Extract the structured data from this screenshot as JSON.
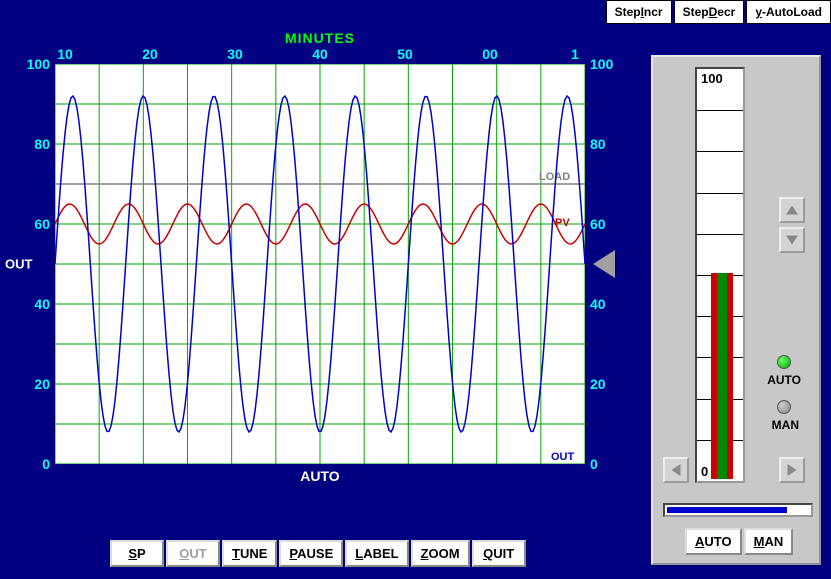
{
  "top_tabs": {
    "step_incr": "StepIncr",
    "step_decr": "StepDecr",
    "autoload": "y-AutoLoad"
  },
  "chart_data": {
    "type": "line",
    "title_top": "MINUTES",
    "x_ticks": [
      "10",
      "20",
      "30",
      "40",
      "50",
      "00",
      "1"
    ],
    "ylim": [
      0,
      100
    ],
    "y_ticks_left": [
      100,
      80,
      60,
      40,
      20,
      0
    ],
    "y_ticks_right": [
      100,
      80,
      60,
      40,
      20,
      0
    ],
    "y_left_label": "OUT",
    "series": [
      {
        "name": "LOAD",
        "color": "#808080",
        "type": "line",
        "level": 70
      },
      {
        "name": "PV",
        "color": "#cc0000",
        "type": "sine",
        "center": 60,
        "amp": 5,
        "cycles": 9
      },
      {
        "name": "OUT",
        "color": "#0000cc",
        "type": "sine",
        "center": 50,
        "amp": 42,
        "cycles": 7.5
      }
    ],
    "marker_y": 50
  },
  "status_text": "AUTO",
  "buttons": {
    "sp": "SP",
    "out": "OUT",
    "tune": "TUNE",
    "pause": "PAUSE",
    "label": "LABEL",
    "zoom": "ZOOM",
    "quit": "QUIT"
  },
  "bar": {
    "top_value": "100",
    "bottom_value": "0",
    "red_pct": 50,
    "green_pct": 50
  },
  "leds": {
    "auto": "AUTO",
    "man": "MAN"
  },
  "h_slider_pct": 82,
  "mode": {
    "auto": "AUTO",
    "man": "MAN"
  }
}
